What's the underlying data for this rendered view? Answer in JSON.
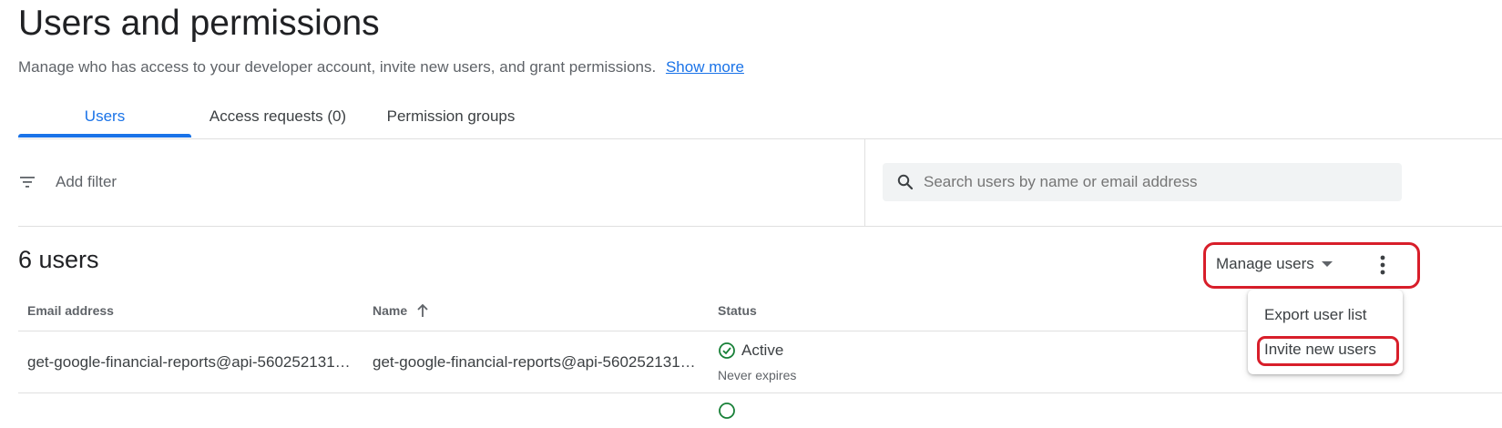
{
  "header": {
    "title": "Users and permissions",
    "description": "Manage who has access to your developer account, invite new users, and grant permissions.",
    "show_more": "Show more"
  },
  "tabs": [
    {
      "label": "Users",
      "active": true
    },
    {
      "label": "Access requests (0)",
      "active": false
    },
    {
      "label": "Permission groups",
      "active": false
    }
  ],
  "filter": {
    "icon": "filter-icon",
    "label": "Add filter"
  },
  "search": {
    "icon": "search-icon",
    "placeholder": "Search users by name or email address"
  },
  "users_count": "6 users",
  "toolbar": {
    "manage_users": "Manage users",
    "manage_icon": "caret-down-icon",
    "more_icon": "more-vert-icon"
  },
  "menu": {
    "items": [
      "Export user list",
      "Invite new users"
    ]
  },
  "table": {
    "columns": [
      "Email address",
      "Name",
      "Status"
    ],
    "sort_icon": "arrow-up-icon",
    "rows": [
      {
        "email": "get-google-financial-reports@api-560252131…",
        "name": "get-google-financial-reports@api-560252131…",
        "status": "Active",
        "status_note": "Never expires"
      }
    ]
  },
  "colors": {
    "accent": "#1a73e8",
    "status_active": "#188038",
    "highlight": "#d81e2a"
  }
}
